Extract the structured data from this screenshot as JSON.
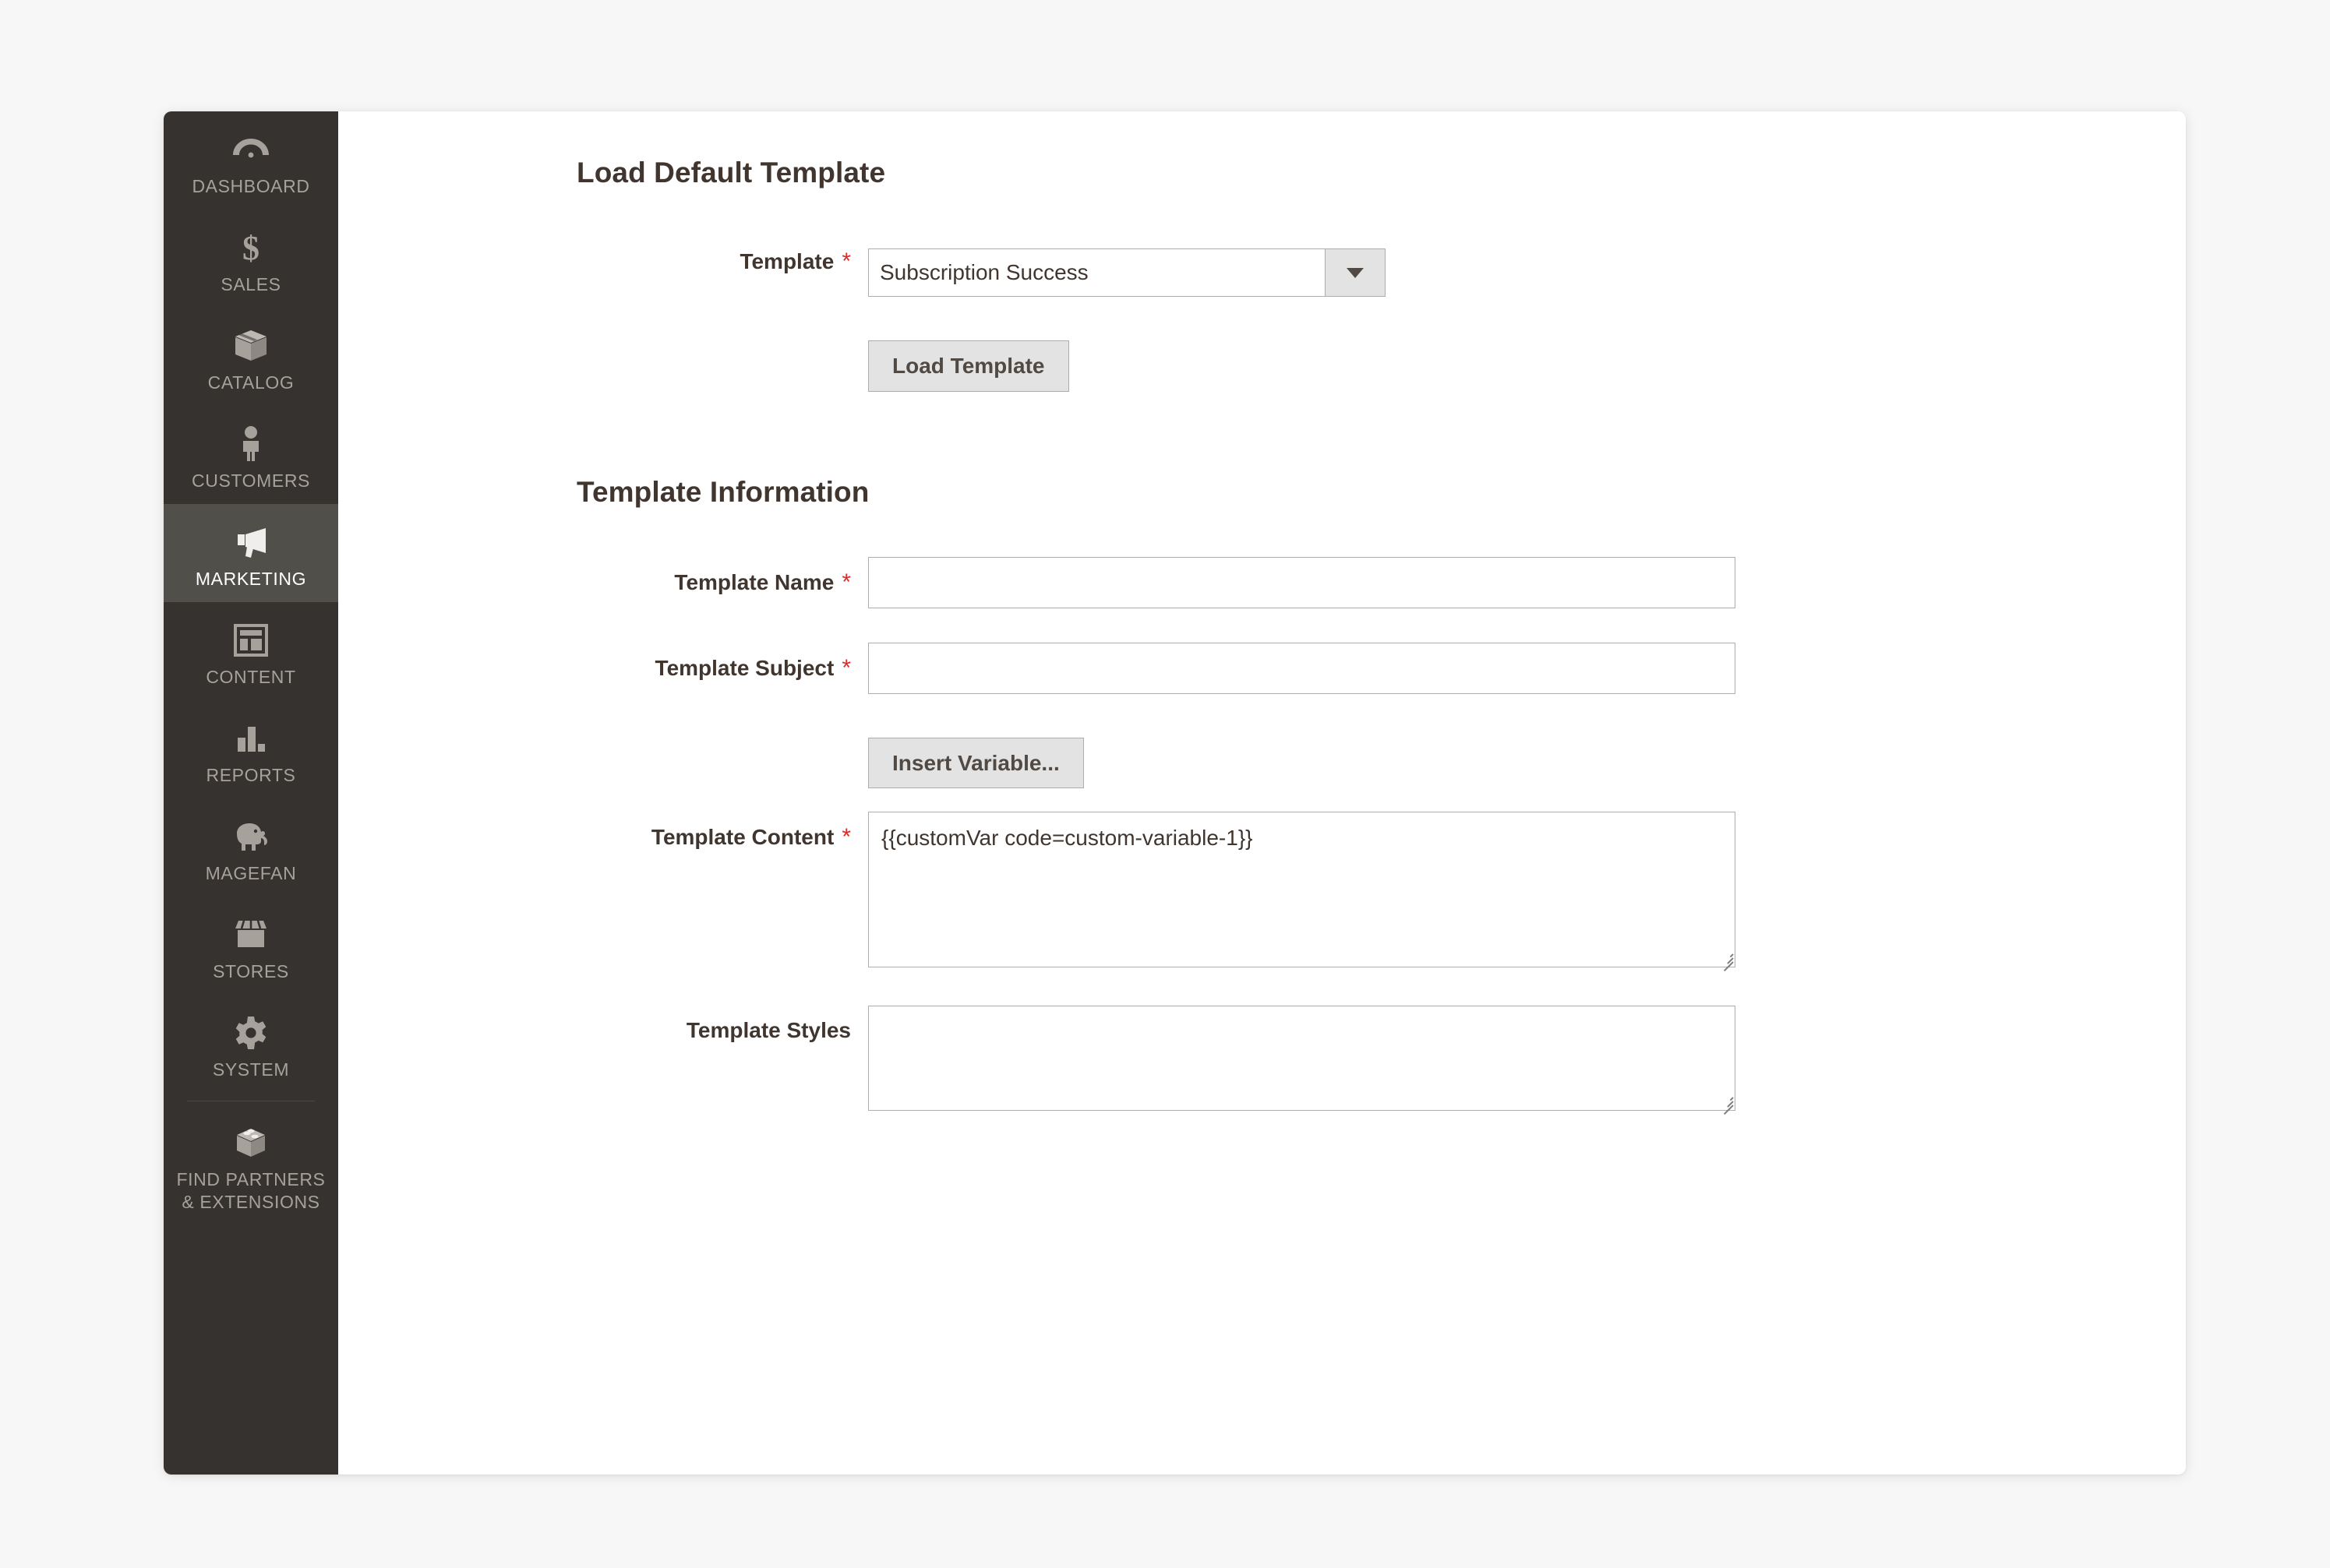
{
  "sidebar": {
    "items": [
      {
        "label": "DASHBOARD",
        "icon": "dashboard-gauge-icon",
        "active": false
      },
      {
        "label": "SALES",
        "icon": "dollar-sign-icon",
        "active": false
      },
      {
        "label": "CATALOG",
        "icon": "box-icon",
        "active": false
      },
      {
        "label": "CUSTOMERS",
        "icon": "person-icon",
        "active": false
      },
      {
        "label": "MARKETING",
        "icon": "megaphone-icon",
        "active": true
      },
      {
        "label": "CONTENT",
        "icon": "layout-page-icon",
        "active": false
      },
      {
        "label": "REPORTS",
        "icon": "bar-chart-icon",
        "active": false
      },
      {
        "label": "MAGEFAN",
        "icon": "elephant-icon",
        "active": false
      },
      {
        "label": "STORES",
        "icon": "storefront-icon",
        "active": false
      },
      {
        "label": "SYSTEM",
        "icon": "gear-icon",
        "active": false
      },
      {
        "label": "FIND PARTNERS\n& EXTENSIONS",
        "icon": "extension-box-icon",
        "active": false
      }
    ],
    "labels": {
      "dashboard": "DASHBOARD",
      "sales": "SALES",
      "catalog": "CATALOG",
      "customers": "CUSTOMERS",
      "marketing": "MARKETING",
      "content": "CONTENT",
      "reports": "REPORTS",
      "magefan": "MAGEFAN",
      "stores": "STORES",
      "system": "SYSTEM",
      "find_partners_line1": "FIND PARTNERS",
      "find_partners_line2": "& EXTENSIONS"
    }
  },
  "load_default_template": {
    "heading": "Load Default Template",
    "template_label": "Template",
    "template_required": "*",
    "template_selected": "Subscription Success",
    "load_button": "Load Template"
  },
  "template_information": {
    "heading": "Template Information",
    "name_label": "Template Name",
    "name_required": "*",
    "name_value": "",
    "subject_label": "Template Subject",
    "subject_required": "*",
    "subject_value": "",
    "insert_variable_button": "Insert Variable...",
    "content_label": "Template Content",
    "content_required": "*",
    "content_value": "{{customVar code=custom-variable-1}}",
    "styles_label": "Template Styles",
    "styles_value": ""
  },
  "colors": {
    "page_background": "#f7f7f7",
    "card_background": "#ffffff",
    "sidebar_background": "#35322f",
    "sidebar_active_background": "#514f4a",
    "sidebar_text": "#a6a19b",
    "sidebar_active_text": "#ffffff",
    "heading_text": "#41362f",
    "required_asterisk": "#e02b27",
    "input_border": "#adadad",
    "button_background": "#e3e3e3",
    "button_text": "#514943"
  }
}
